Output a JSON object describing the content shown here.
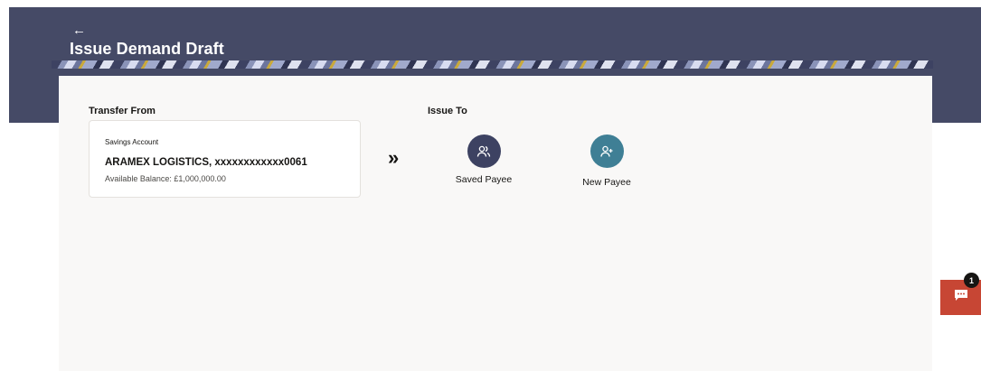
{
  "header": {
    "back_icon": "arrow-left-icon",
    "title": "Issue Demand Draft"
  },
  "transfer_from": {
    "label": "Transfer From",
    "account": {
      "type": "Savings Account",
      "name": "ARAMEX LOGISTICS, xxxxxxxxxxxx0061",
      "balance": "Available Balance: £1,000,000.00"
    }
  },
  "issue_to": {
    "label": "Issue To",
    "options": [
      {
        "label": "Saved Payee",
        "icon": "users-icon",
        "color": "#3d4262"
      },
      {
        "label": "New Payee",
        "icon": "add-user-icon",
        "color": "#3f7f95"
      }
    ]
  },
  "chat": {
    "icon": "chat-icon",
    "badge_count": "1",
    "color": "#c74634"
  }
}
